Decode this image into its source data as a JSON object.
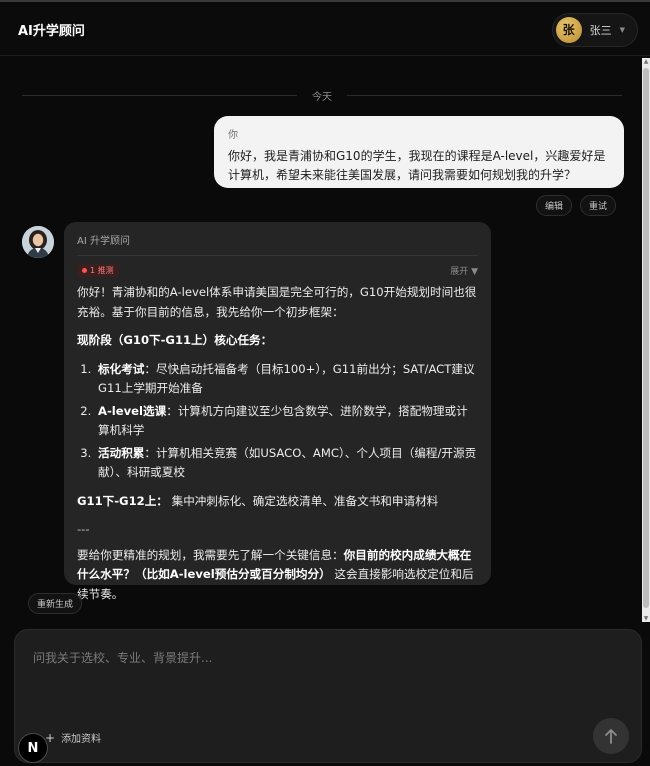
{
  "header": {
    "title": "AI升学顾问",
    "user_initial": "张",
    "user_name": "张三"
  },
  "chat": {
    "date_divider": "今天",
    "user_message": {
      "sender": "你",
      "text": "你好，我是青浦协和G10的学生，我现在的课程是A-level，兴趣爱好是计算机，希望未来能往美国发展，请问我需要如何规划我的升学？"
    },
    "message_actions": [
      "编辑",
      "重试"
    ],
    "bot_message": {
      "sender": "AI 升学顾问",
      "badge": "1 推测",
      "expand_label": "展开 ▼",
      "intro": "你好！青浦协和的A-level体系申请美国是完全可行的，G10开始规划时间也很充裕。基于你目前的信息，我先给你一个初步框架：",
      "section1_title": "现阶段（G10下-G11上）核心任务：",
      "items": [
        {
          "title": "标化考试",
          "text": "：尽快启动托福备考（目标100+），G11前出分；SAT/ACT建议G11上学期开始准备"
        },
        {
          "title": "A-level选课",
          "text": "：计算机方向建议至少包含数学、进阶数学，搭配物理或计算机科学"
        },
        {
          "title": "活动积累",
          "text": "：计算机相关竞赛（如USACO、AMC）、个人项目（编程/开源贡献）、科研或夏校"
        }
      ],
      "section2_title": "G11下-G12上：",
      "section2_text": "集中冲刺标化、确定选校清单、准备文书和申请材料",
      "separator": "---",
      "closing_pre": "要给你更精准的规划，我需要先了解一个关键信息：",
      "closing_bold": "你目前的校内成绩大概在什么水平？（比如A-level预估分或百分制均分）",
      "closing_post": "这会直接影响选校定位和后续节奏。"
    },
    "regenerate_label": "重新生成"
  },
  "composer": {
    "placeholder": "问我关于选校、专业、背景提升...",
    "attach_label": "添加资料",
    "send_icon": "arrow-up-icon"
  },
  "corner_badge": "N"
}
